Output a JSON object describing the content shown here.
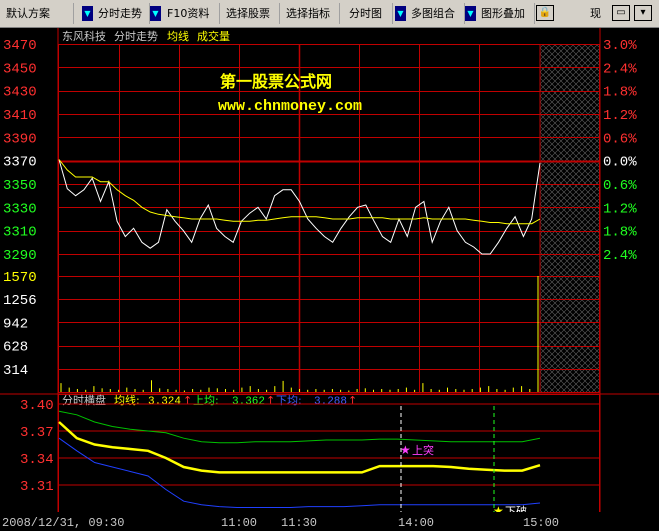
{
  "toolbar": {
    "items": [
      "默认方案",
      "分时走势",
      "F10资料",
      "选择股票",
      "选择指标",
      "分时图",
      "多图组合",
      "图形叠加",
      "现"
    ]
  },
  "main_panel": {
    "stock_name": "东风科技",
    "chart_label": "分时走势",
    "avg_label": "均线",
    "volume_label": "成交量",
    "watermark_title": "第一股票公式网",
    "watermark_url": "www.chnmoney.com",
    "price_ticks": [
      "3470",
      "3450",
      "3430",
      "3410",
      "3390",
      "3370",
      "3350",
      "3330",
      "3310",
      "3290"
    ],
    "pct_ticks": [
      "3.0%",
      "2.4%",
      "1.8%",
      "1.2%",
      "0.6%",
      "0.0%",
      "0.6%",
      "1.2%",
      "1.8%",
      "2.4%"
    ],
    "volume_ticks": [
      "1570",
      "1256",
      "942",
      "628",
      "314"
    ]
  },
  "sub_panel": {
    "title": "分时横盘",
    "avg_label": "均线:",
    "avg_value": "3.324",
    "upper_label": "上均:",
    "upper_value": "3.362",
    "lower_label": "下均:",
    "lower_value": "3.288",
    "ticks": [
      "3.40",
      "3.37",
      "3.34",
      "3.31"
    ],
    "marker_up": "上突",
    "marker_down": "下破"
  },
  "time_axis": {
    "datetime": "2008/12/31, 09:30",
    "ticks": [
      "11:00",
      "11:30",
      "14:00",
      "15:00"
    ]
  },
  "colors": {
    "price_line": "#ffffff",
    "avg_line": "#ffff00",
    "grid": "#c00000",
    "up_pct": "#ff3030",
    "down_pct": "#20ff20",
    "upper_line": "#00c000",
    "lower_line": "#2040ff",
    "mid_line": "#ffff00"
  },
  "chart_data": [
    {
      "type": "line",
      "title": "分时走势",
      "y_range": [
        3290,
        3470
      ],
      "series": [
        {
          "name": "分时走势",
          "values": [
            3371,
            3346,
            3340,
            3345,
            3355,
            3335,
            3352,
            3318,
            3305,
            3312,
            3300,
            3295,
            3300,
            3328,
            3318,
            3310,
            3300,
            3320,
            3332,
            3312,
            3305,
            3300,
            3318,
            3325,
            3330,
            3320,
            3340,
            3345,
            3345,
            3335,
            3320,
            3312,
            3305,
            3300,
            3312,
            3322,
            3330,
            3332,
            3318,
            3305,
            3300,
            3320,
            3305,
            3330,
            3335,
            3300,
            3318,
            3330,
            3310,
            3300,
            3296,
            3290,
            3290,
            3300,
            3312,
            3322,
            3305,
            3320,
            3368
          ]
        },
        {
          "name": "均线",
          "values": [
            3371,
            3362,
            3356,
            3356,
            3356,
            3352,
            3352,
            3345,
            3340,
            3336,
            3330,
            3326,
            3324,
            3323,
            3322,
            3321,
            3320,
            3320,
            3320,
            3320,
            3319,
            3318,
            3318,
            3318,
            3319,
            3319,
            3320,
            3321,
            3322,
            3322,
            3322,
            3322,
            3321,
            3320,
            3320,
            3320,
            3321,
            3321,
            3321,
            3321,
            3320,
            3320,
            3320,
            3320,
            3321,
            3320,
            3320,
            3320,
            3320,
            3320,
            3319,
            3318,
            3317,
            3317,
            3316,
            3316,
            3316,
            3316,
            3320
          ]
        }
      ]
    },
    {
      "type": "bar",
      "title": "成交量",
      "y_range": [
        0,
        1570
      ],
      "series": [
        {
          "name": "成交量",
          "values": [
            120,
            60,
            40,
            30,
            80,
            50,
            40,
            30,
            60,
            40,
            30,
            160,
            50,
            40,
            30,
            20,
            40,
            30,
            60,
            50,
            40,
            30,
            60,
            80,
            40,
            30,
            80,
            150,
            60,
            40,
            30,
            40,
            30,
            40,
            30,
            20,
            40,
            50,
            30,
            40,
            30,
            40,
            60,
            30,
            120,
            40,
            30,
            60,
            40,
            30,
            40,
            60,
            80,
            40,
            30,
            60,
            80,
            40,
            1570
          ]
        }
      ]
    },
    {
      "type": "line",
      "title": "分时横盘",
      "y_range": [
        3.28,
        3.4
      ],
      "series": [
        {
          "name": "上均",
          "values": [
            3.392,
            3.388,
            3.38,
            3.375,
            3.372,
            3.37,
            3.368,
            3.362,
            3.358,
            3.357,
            3.357,
            3.358,
            3.358,
            3.358,
            3.359,
            3.36,
            3.36,
            3.36,
            3.361,
            3.361,
            3.36,
            3.359,
            3.358,
            3.358,
            3.358,
            3.358,
            3.358,
            3.362
          ]
        },
        {
          "name": "均线",
          "values": [
            3.38,
            3.362,
            3.355,
            3.352,
            3.35,
            3.348,
            3.34,
            3.33,
            3.326,
            3.324,
            3.324,
            3.324,
            3.324,
            3.324,
            3.324,
            3.324,
            3.324,
            3.324,
            3.331,
            3.331,
            3.331,
            3.331,
            3.33,
            3.328,
            3.327,
            3.326,
            3.326,
            3.332
          ]
        },
        {
          "name": "下均",
          "values": [
            3.362,
            3.348,
            3.335,
            3.33,
            3.325,
            3.32,
            3.305,
            3.292,
            3.288,
            3.286,
            3.285,
            3.285,
            3.285,
            3.285,
            3.286,
            3.286,
            3.286,
            3.287,
            3.288,
            3.288,
            3.288,
            3.288,
            3.288,
            3.288,
            3.288,
            3.288,
            3.288,
            3.29
          ]
        }
      ]
    }
  ]
}
